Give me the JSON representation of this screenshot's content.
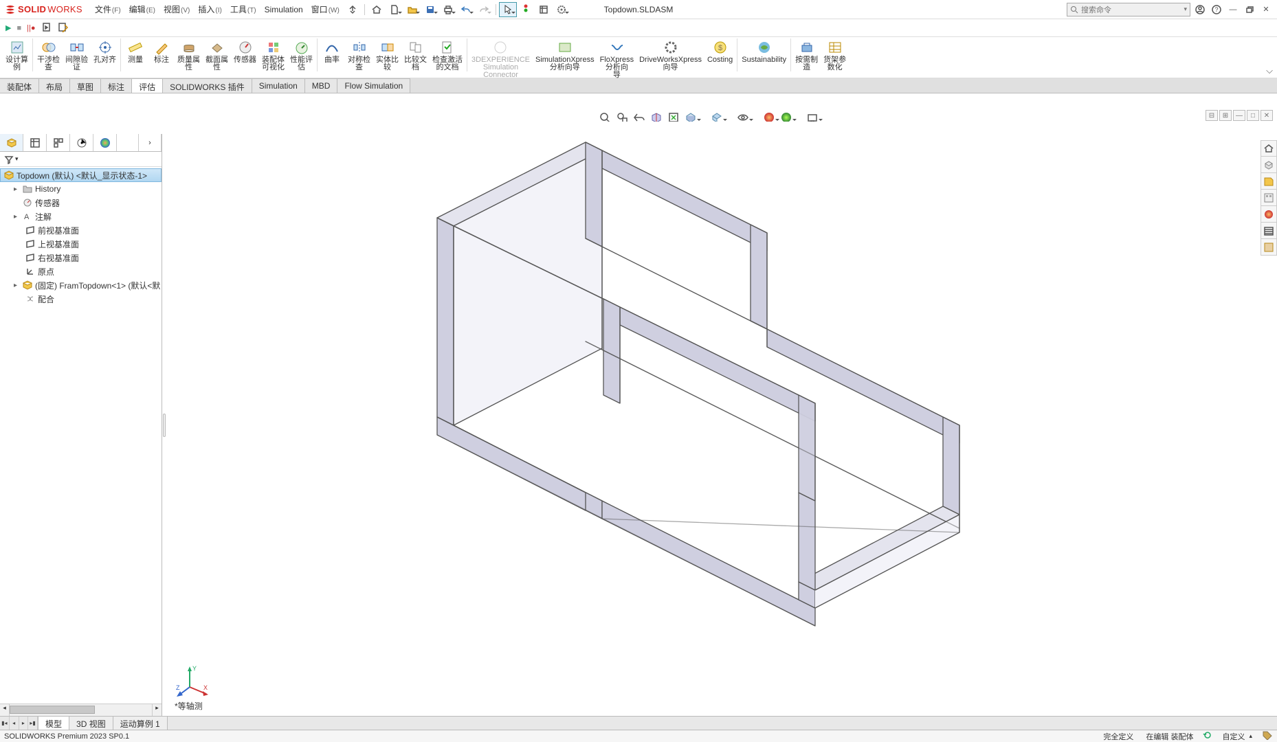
{
  "app": {
    "brand1": "SOLID",
    "brand2": "WORKS",
    "title": "Topdown.SLDASM",
    "search_placeholder": "搜索命令"
  },
  "menu": {
    "file": "文件",
    "file_k": "(F)",
    "edit": "编辑",
    "edit_k": "(E)",
    "view": "视图",
    "view_k": "(V)",
    "insert": "插入",
    "insert_k": "(I)",
    "tools": "工具",
    "tools_k": "(T)",
    "sim": "Simulation",
    "window": "窗口",
    "window_k": "(W)"
  },
  "ribbon": {
    "r0": "设计算\n例",
    "r1": "干涉检\n查",
    "r2": "间隙验\n证",
    "r3": "孔对齐",
    "r4": "测量",
    "r5": "标注",
    "r6": "质量属\n性",
    "r7": "截面属\n性",
    "r8": "传感器",
    "r9": "装配体\n可视化",
    "r10": "性能评\n估",
    "r11": "曲率",
    "r12": "对称检\n查",
    "r13": "实体比\n较",
    "r14": "比较文\n档",
    "r15": "检查激活\n的文档",
    "r16a": "3DEXPERIENCE",
    "r16b": "Simulation",
    "r16c": "Connector",
    "r17": "SimulationXpress\n分析向导",
    "r18": "FloXpress\n分析向\n导",
    "r19": "DriveWorksXpress\n向导",
    "r20": "Costing",
    "r21": "Sustainability",
    "r22": "按需制\n造",
    "r23": "货架参\n数化"
  },
  "subtabs": {
    "t0": "装配体",
    "t1": "布局",
    "t2": "草图",
    "t3": "标注",
    "t4": "评估",
    "t5": "SOLIDWORKS 插件",
    "t6": "Simulation",
    "t7": "MBD",
    "t8": "Flow Simulation"
  },
  "tree": {
    "root": "Topdown (默认) <默认_显示状态-1>",
    "history": "History",
    "sensors": "传感器",
    "annotations": "注解",
    "front": "前视基准面",
    "top": "上视基准面",
    "right": "右视基准面",
    "origin": "原点",
    "comp": "(固定) FramTopdown<1> (默认<默",
    "mates": "配合"
  },
  "viewport": {
    "orientation_label": "*等轴测"
  },
  "bottom_tabs": {
    "b0": "模型",
    "b1": "3D 视图",
    "b2": "运动算例 1"
  },
  "status": {
    "left": "SOLIDWORKS Premium 2023 SP0.1",
    "def": "完全定义",
    "mode": "在编辑 装配体",
    "custom": "自定义"
  }
}
